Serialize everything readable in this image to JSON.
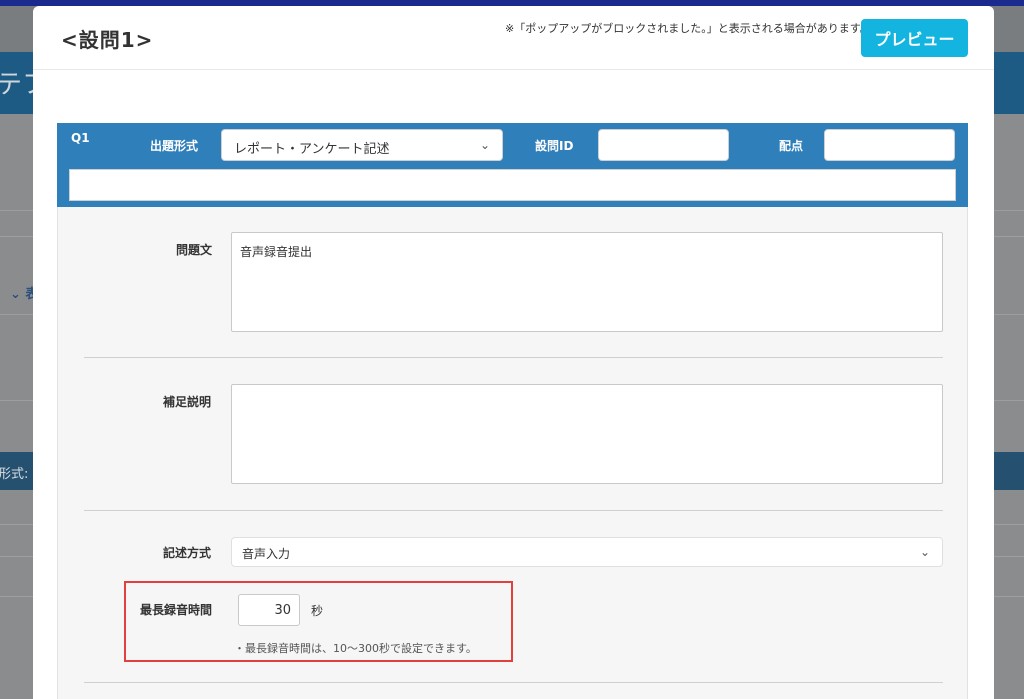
{
  "modal": {
    "title": "<設問1>",
    "note": "※「ポップアップがブロックされました。」と表示される場合があります。",
    "preview_label": "プレビュー"
  },
  "question": {
    "number": "Q1",
    "type_label": "出題形式",
    "type_value": "レポート・アンケート記述",
    "id_label": "設問ID",
    "id_value": "",
    "score_label": "配点",
    "score_value": ""
  },
  "fields": {
    "body_label": "問題文",
    "body_value": "音声録音提出",
    "supplement_label": "補足説明",
    "supplement_value": "",
    "method_label": "記述方式",
    "method_value": "音声入力",
    "max_time_label": "最長録音時間",
    "max_time_value": "30",
    "max_time_unit": "秒",
    "max_time_hint": "・最長録音時間は、10〜300秒で設定できます。"
  },
  "background": {
    "title_fragment": "テフ",
    "sort_fragment": "⌄ 表",
    "strip_fragment": "形式:"
  },
  "colors": {
    "accent": "#13b5e0",
    "question_header": "#2f7fbb",
    "highlight": "#e2403f"
  }
}
